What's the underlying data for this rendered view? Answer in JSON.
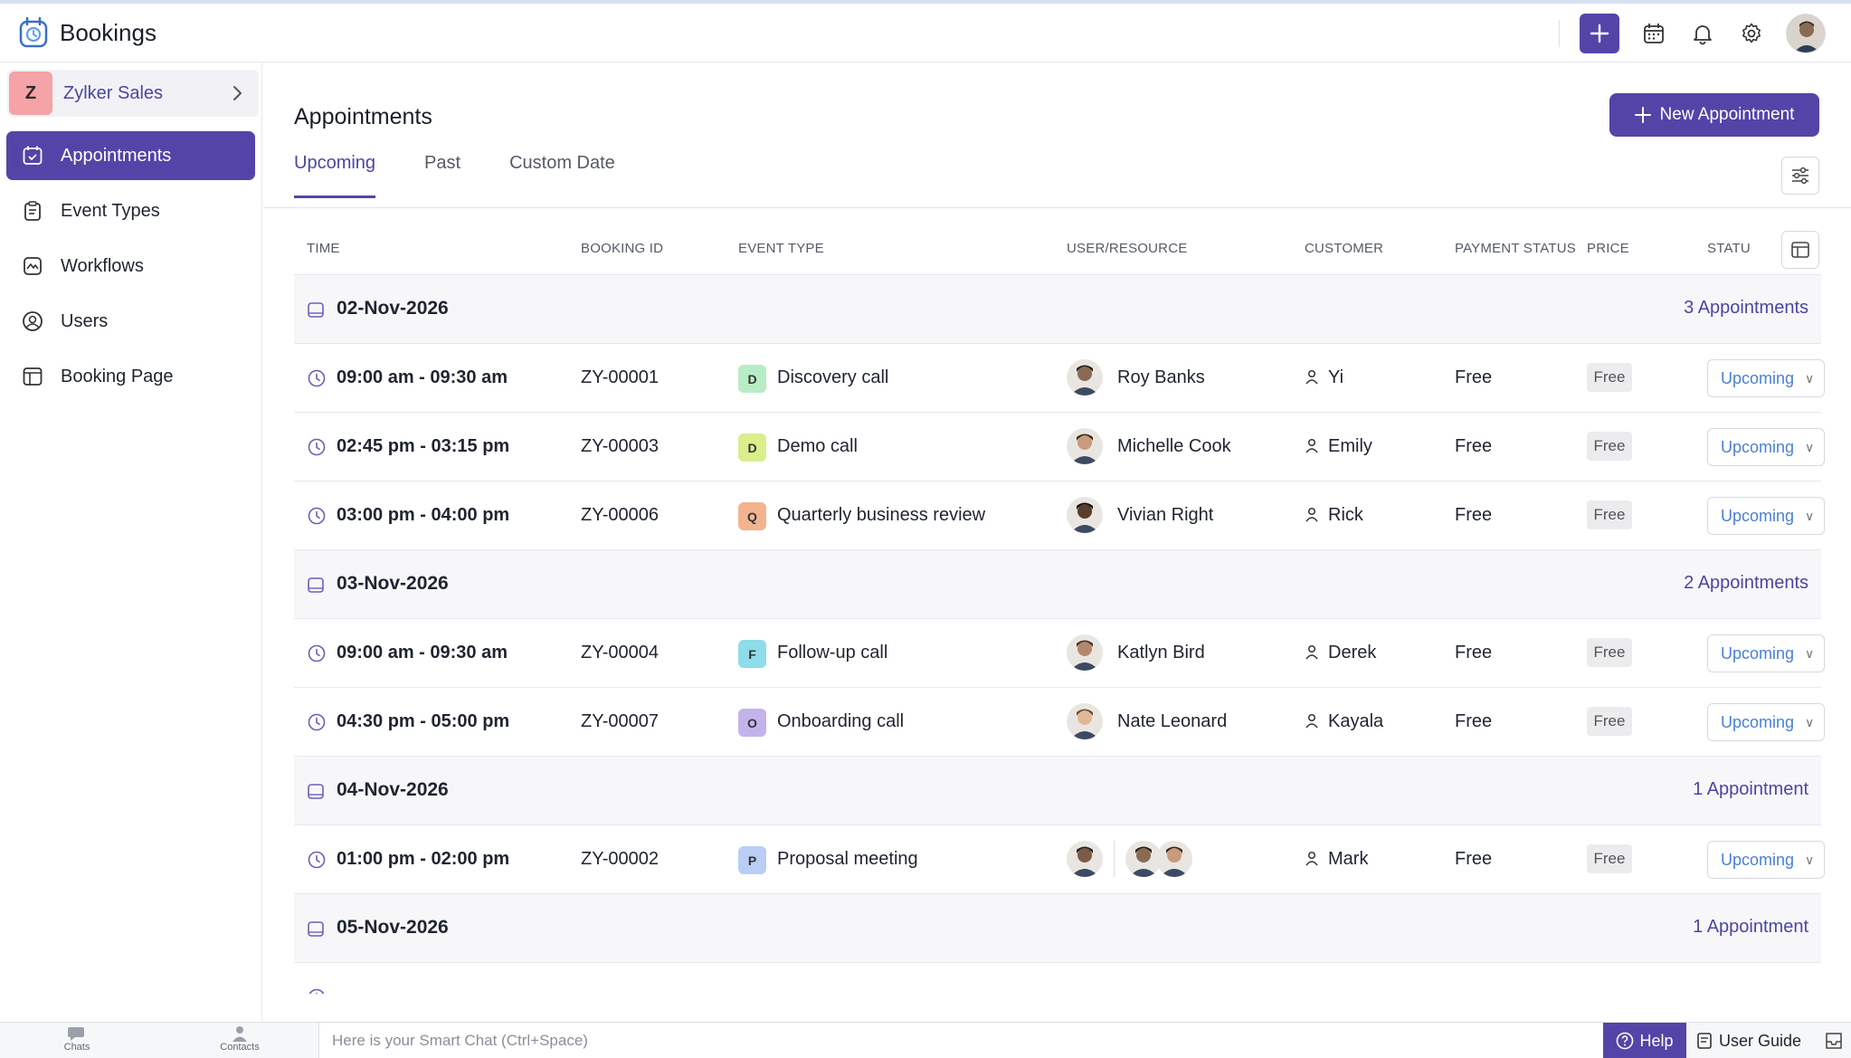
{
  "app": {
    "title": "Bookings"
  },
  "workspace": {
    "badge": "Z",
    "name": "Zylker Sales"
  },
  "sidebar": {
    "items": [
      {
        "label": "Appointments",
        "icon": "calendar-check-icon",
        "active": true
      },
      {
        "label": "Event Types",
        "icon": "clipboard-icon"
      },
      {
        "label": "Workflows",
        "icon": "workflow-icon"
      },
      {
        "label": "Users",
        "icon": "user-circle-icon"
      },
      {
        "label": "Booking Page",
        "icon": "layout-icon"
      }
    ]
  },
  "page": {
    "title": "Appointments",
    "new_button": "New Appointment"
  },
  "tabs": [
    {
      "label": "Upcoming",
      "active": true
    },
    {
      "label": "Past"
    },
    {
      "label": "Custom Date"
    }
  ],
  "table": {
    "columns": [
      "TIME",
      "BOOKING ID",
      "EVENT TYPE",
      "USER/RESOURCE",
      "CUSTOMER",
      "PAYMENT STATUS",
      "PRICE",
      "STATU"
    ],
    "groups": [
      {
        "date": "02-Nov-2026",
        "count": "3 Appointments",
        "rows": [
          {
            "time": "09:00 am - 09:30 am",
            "id": "ZY-00001",
            "event_letter": "D",
            "event_color": "#b8ecc4",
            "event": "Discovery call",
            "user": "Roy Banks",
            "customer": "Yi",
            "payment": "Free",
            "price": "Free",
            "status": "Upcoming"
          },
          {
            "time": "02:45 pm - 03:15 pm",
            "id": "ZY-00003",
            "event_letter": "D",
            "event_color": "#d9ef8c",
            "event": "Demo call",
            "user": "Michelle Cook",
            "customer": "Emily",
            "payment": "Free",
            "price": "Free",
            "status": "Upcoming"
          },
          {
            "time": "03:00 pm - 04:00 pm",
            "id": "ZY-00006",
            "event_letter": "Q",
            "event_color": "#f2b48f",
            "event": "Quarterly business review",
            "user": "Vivian Right",
            "customer": "Rick",
            "payment": "Free",
            "price": "Free",
            "status": "Upcoming"
          }
        ]
      },
      {
        "date": "03-Nov-2026",
        "count": "2 Appointments",
        "rows": [
          {
            "time": "09:00 am - 09:30 am",
            "id": "ZY-00004",
            "event_letter": "F",
            "event_color": "#8fdcea",
            "event": "Follow-up call",
            "user": "Katlyn Bird",
            "customer": "Derek",
            "payment": "Free",
            "price": "Free",
            "status": "Upcoming"
          },
          {
            "time": "04:30 pm - 05:00 pm",
            "id": "ZY-00007",
            "event_letter": "O",
            "event_color": "#c3b3ea",
            "event": "Onboarding call",
            "user": "Nate Leonard",
            "customer": "Kayala",
            "payment": "Free",
            "price": "Free",
            "status": "Upcoming"
          }
        ]
      },
      {
        "date": "04-Nov-2026",
        "count": "1 Appointment",
        "rows": [
          {
            "time": "01:00 pm - 02:00 pm",
            "id": "ZY-00002",
            "event_letter": "P",
            "event_color": "#b9cdf5",
            "event": "Proposal meeting",
            "user": "",
            "customer": "Mark",
            "payment": "Free",
            "price": "Free",
            "status": "Upcoming",
            "multi": true
          }
        ]
      },
      {
        "date": "05-Nov-2026",
        "count": "1 Appointment",
        "rows": []
      }
    ]
  },
  "bottombar": {
    "chats": "Chats",
    "contacts": "Contacts",
    "smartchat_placeholder": "Here is your Smart Chat (Ctrl+Space)",
    "help": "Help",
    "guide": "User Guide"
  }
}
